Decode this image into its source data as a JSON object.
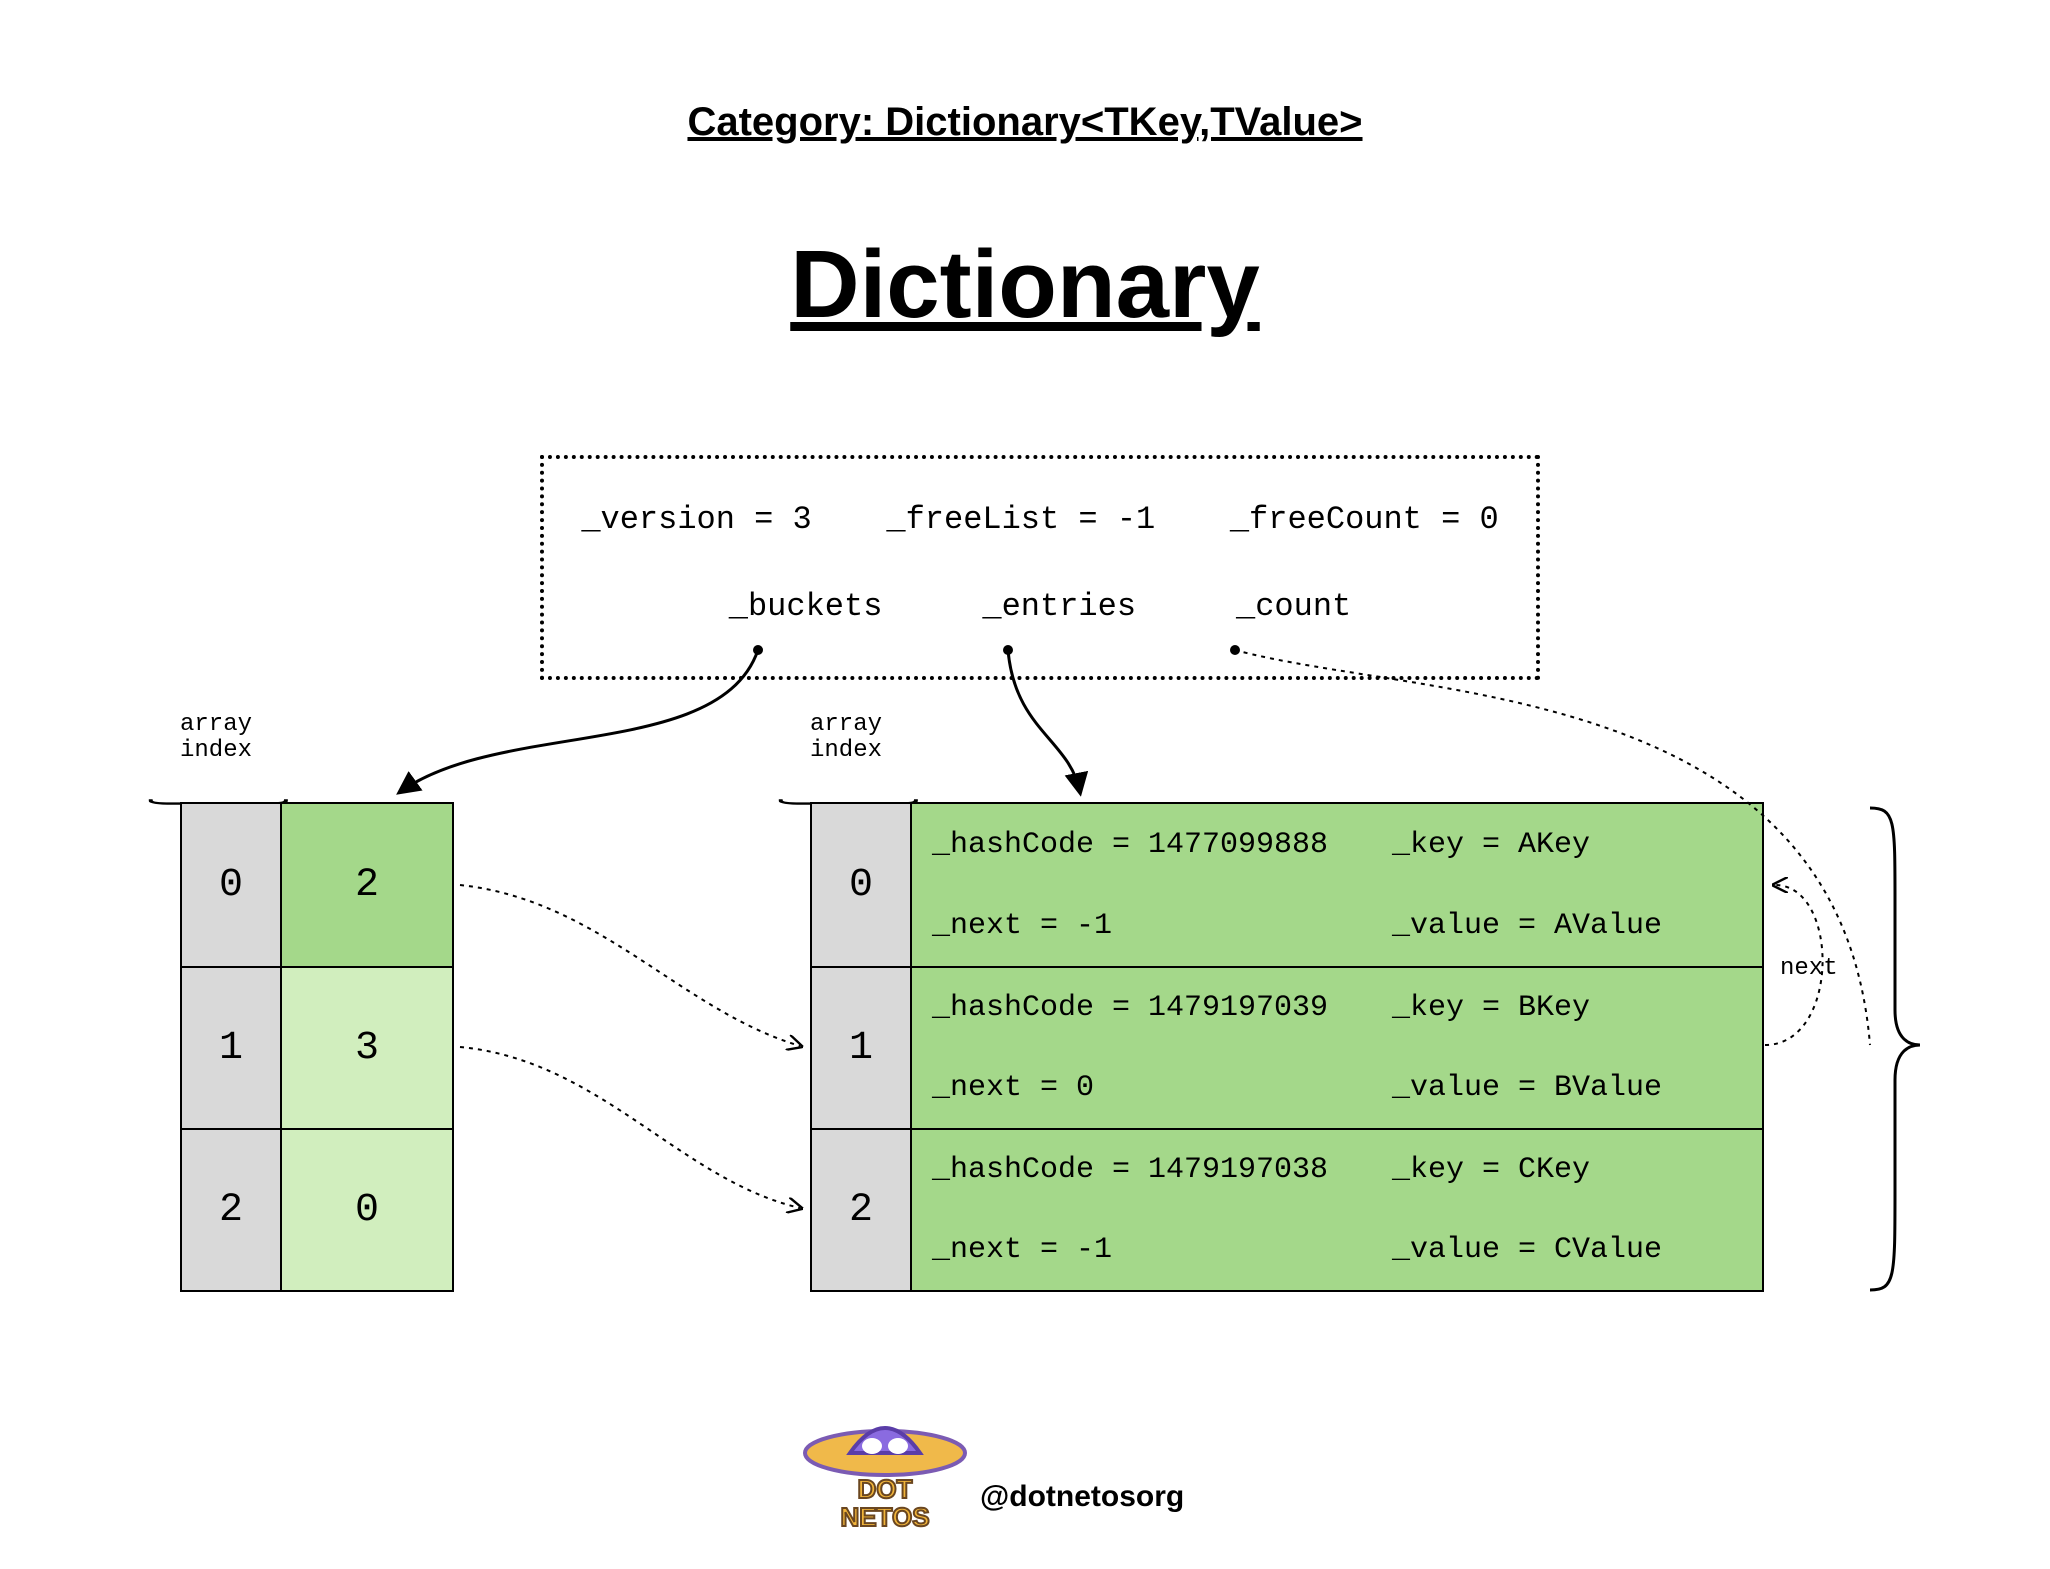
{
  "header": {
    "category": "Category: Dictionary<TKey,TValue>",
    "title": "Dictionary"
  },
  "state": {
    "version_label": "_version = 3",
    "freeList_label": "_freeList = -1",
    "freeCount_label": "_freeCount = 0",
    "buckets_label": "_buckets",
    "entries_label": "_entries",
    "count_label": "_count"
  },
  "labels": {
    "array_index_left": "array\nindex",
    "array_index_right": "array\nindex",
    "next": "next"
  },
  "buckets": [
    {
      "index": "0",
      "value": "2",
      "highlight": "hit"
    },
    {
      "index": "1",
      "value": "3",
      "highlight": "filled"
    },
    {
      "index": "2",
      "value": "0",
      "highlight": "filled"
    }
  ],
  "entries": [
    {
      "index": "0",
      "hashCode": "_hashCode = 1477099888",
      "next": "_next = -1",
      "key": "_key = AKey",
      "value": "_value = AValue"
    },
    {
      "index": "1",
      "hashCode": "_hashCode = 1479197039",
      "next": "_next = 0",
      "key": "_key = BKey",
      "value": "_value = BValue"
    },
    {
      "index": "2",
      "hashCode": "_hashCode = 1479197038",
      "next": "_next = -1",
      "key": "_key = CKey",
      "value": "_value = CValue"
    }
  ],
  "footer": {
    "handle": "@dotnetosorg",
    "logo_top": "DOT",
    "logo_bottom": "NETOS"
  }
}
